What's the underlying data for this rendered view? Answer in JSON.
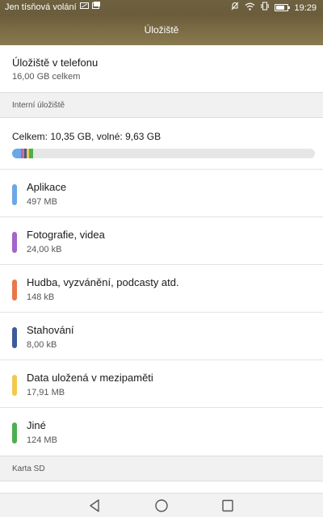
{
  "status_bar": {
    "carrier_text": "Jen tísňová volání",
    "time": "19:29",
    "icons": [
      "no-sim-icon",
      "photo-notification-icon",
      "silent-mode-icon",
      "wifi-icon",
      "vibrate-icon",
      "battery-icon"
    ]
  },
  "title_bar": {
    "title": "Úložiště"
  },
  "phone_storage": {
    "title": "Úložiště v telefonu",
    "subtitle": "16,00 GB celkem"
  },
  "internal_section": {
    "label": "Interní úložiště"
  },
  "usage": {
    "summary": "Celkem: 10,35 GB, volné: 9,63 GB",
    "bar_segments": [
      {
        "name": "Aplikace",
        "fraction": 0.028,
        "color": "#6aa8e8"
      },
      {
        "name": "Fotografie, videa",
        "fraction": 0.006,
        "color": "#a365c9"
      },
      {
        "name": "Hudba, vyzvánění, podcasty atd.",
        "fraction": 0.006,
        "color": "#e8774a"
      },
      {
        "name": "Stahování",
        "fraction": 0.008,
        "color": "#3e5a9c"
      },
      {
        "name": "Data uložená v mezipaměti",
        "fraction": 0.008,
        "color": "#f2c94c"
      },
      {
        "name": "Jiné",
        "fraction": 0.012,
        "color": "#4caf50"
      }
    ]
  },
  "categories": [
    {
      "name": "Aplikace",
      "size": "497 MB",
      "color": "#6aa8e8"
    },
    {
      "name": "Fotografie, videa",
      "size": "24,00 kB",
      "color": "#a365c9"
    },
    {
      "name": "Hudba, vyzvánění, podcasty atd.",
      "size": "148 kB",
      "color": "#e8774a"
    },
    {
      "name": "Stahování",
      "size": "8,00 kB",
      "color": "#3e5a9c"
    },
    {
      "name": "Data uložená v mezipaměti",
      "size": "17,91 MB",
      "color": "#f2c94c"
    },
    {
      "name": "Jiné",
      "size": "124 MB",
      "color": "#4caf50"
    }
  ],
  "sd_section": {
    "label": "Karta SD"
  },
  "nav_bar": {
    "buttons": [
      "back-icon",
      "home-icon",
      "recents-icon"
    ]
  }
}
